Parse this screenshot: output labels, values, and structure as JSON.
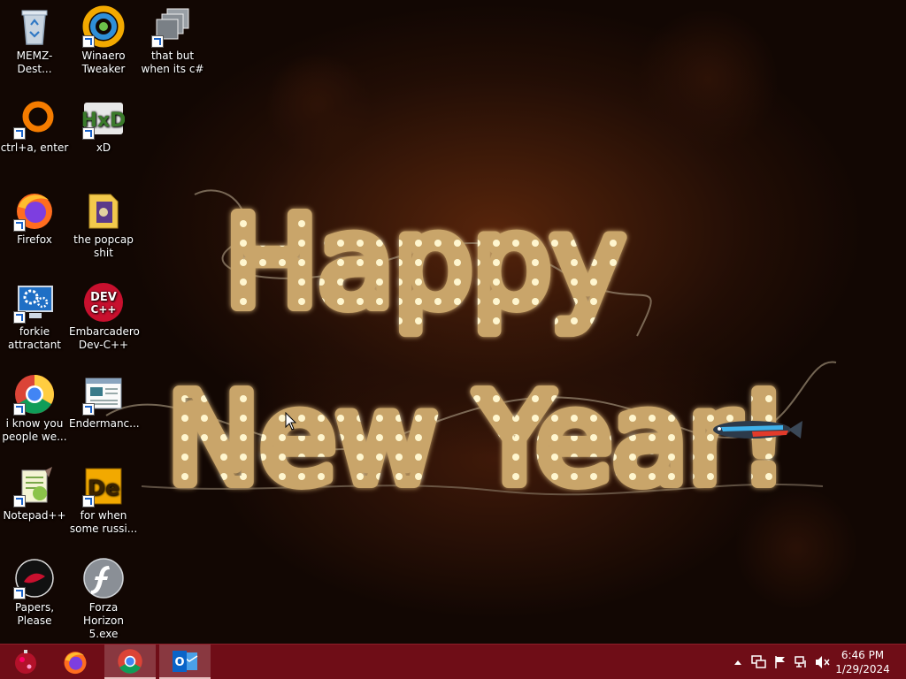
{
  "desktop": {
    "wallpaper": {
      "line1": "Happy",
      "line2": "New Year!"
    },
    "icons": [
      {
        "label": "MEMZ-Dest...",
        "icon": "recycle-bin-icon"
      },
      {
        "label": "Winaero Tweaker",
        "icon": "winaero-tweaker-icon"
      },
      {
        "label": "that but when its c#",
        "icon": "windows-stack-icon"
      },
      {
        "label": "ctrl+a, enter",
        "icon": "orange-ring-icon"
      },
      {
        "label": "xD",
        "icon": "hxd-editor-icon"
      },
      {
        "label": "Firefox",
        "icon": "firefox-icon"
      },
      {
        "label": "the popcap shit",
        "icon": "folder-icon"
      },
      {
        "label": "forkie attractant",
        "icon": "monitor-gear-icon"
      },
      {
        "label": "Embarcadero Dev-C++",
        "icon": "devcpp-icon"
      },
      {
        "label": "i know you people we...",
        "icon": "chrome-icon"
      },
      {
        "label": "Endermanc...",
        "icon": "window-app-icon"
      },
      {
        "label": "Notepad++",
        "icon": "notepadpp-icon"
      },
      {
        "label": "for when some russi...",
        "icon": "de-app-icon"
      },
      {
        "label": "Papers, Please",
        "icon": "papers-please-icon"
      },
      {
        "label": "Forza Horizon 5.exe",
        "icon": "flash-player-icon"
      }
    ],
    "dev_badge": "DEV",
    "dev_sub": "C++",
    "hxd_badge": "HxD",
    "de_badge": "De"
  },
  "taskbar": {
    "color": "#6f0d17",
    "pinned": [
      "start-orb-icon",
      "firefox-icon",
      "chrome-icon",
      "outlook-icon"
    ],
    "outlook_letter": "O",
    "clock": {
      "time": "6:46 PM",
      "date": "1/29/2024"
    },
    "tray": [
      "show-hidden-icons",
      "action-center-icon",
      "flag-icon",
      "network-icon",
      "volume-muted-icon"
    ]
  }
}
